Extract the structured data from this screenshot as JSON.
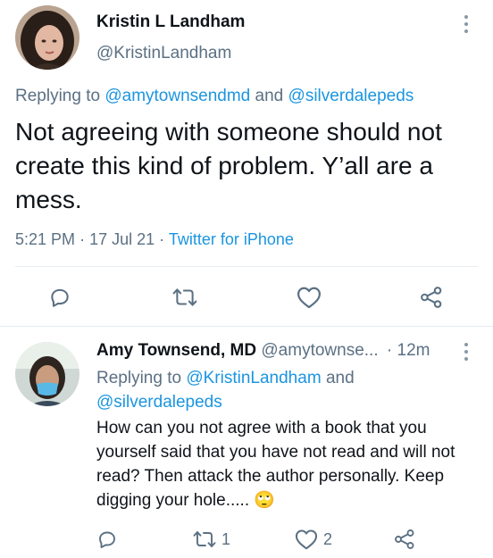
{
  "main_tweet": {
    "author_name": "Kristin L Landham",
    "author_handle": "@KristinLandham",
    "replying_prefix": "Replying to",
    "replying_handle_1": "@amytownsendmd",
    "replying_and": "and",
    "replying_handle_2": "@silverdalepeds",
    "text": "Not agreeing with someone should not create this kind of problem. Y’all are a mess.",
    "time": "5:21 PM",
    "date": "17 Jul 21",
    "sep1": "·",
    "sep2": "·",
    "client": "Twitter for iPhone"
  },
  "reply_tweet": {
    "author_name": "Amy Townsend, MD",
    "author_handle": "@amytownse...",
    "separator": "·",
    "age": "12m",
    "replying_prefix": "Replying to",
    "replying_handle_1": "@KristinLandham",
    "replying_and": "and",
    "replying_handle_2": "@silverdalepeds",
    "text": "How can you not agree with a book that you yourself said that you have not read and will not read?  Then attack the author personally. Keep digging your hole.....",
    "emoji": "🙄",
    "retweet_count": "1",
    "like_count": "2"
  },
  "colors": {
    "link": "#1b95e0",
    "secondary_text": "#5b7083",
    "divider": "#e6ecf0"
  }
}
